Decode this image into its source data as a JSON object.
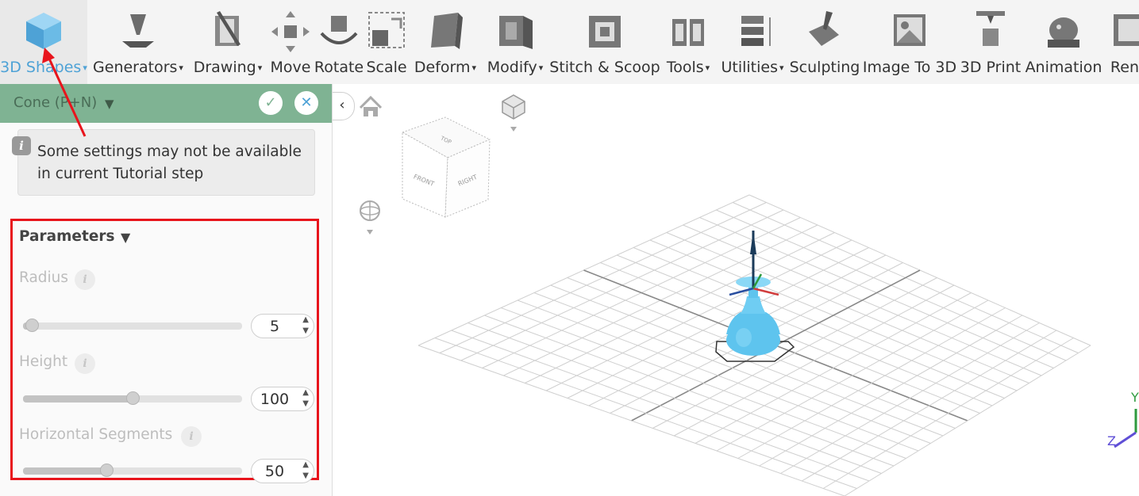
{
  "toolbar": {
    "items": [
      {
        "label": "3D Shapes",
        "icon": "cube-icon",
        "caret": "▾",
        "active": true
      },
      {
        "label": "Generators",
        "icon": "generator-icon",
        "caret": "▾"
      },
      {
        "label": "Drawing",
        "icon": "drawing-icon",
        "caret": "▾"
      },
      {
        "label": "Move",
        "icon": "move-icon",
        "caret": ""
      },
      {
        "label": "Rotate",
        "icon": "rotate-icon",
        "caret": ""
      },
      {
        "label": "Scale",
        "icon": "scale-icon",
        "caret": ""
      },
      {
        "label": "Deform",
        "icon": "deform-icon",
        "caret": "▾"
      },
      {
        "label": "Modify",
        "icon": "modify-icon",
        "caret": "▾"
      },
      {
        "label": "Stitch & Scoop",
        "icon": "stitch-scoop-icon",
        "caret": ""
      },
      {
        "label": "Tools",
        "icon": "tools-icon",
        "caret": "▾"
      },
      {
        "label": "Utilities",
        "icon": "utilities-icon",
        "caret": "▾"
      },
      {
        "label": "Sculpting",
        "icon": "sculpting-icon",
        "caret": ""
      },
      {
        "label": "Image To 3D",
        "icon": "image-to-3d-icon",
        "caret": ""
      },
      {
        "label": "3D Print",
        "icon": "3d-print-icon",
        "caret": ""
      },
      {
        "label": "Animation",
        "icon": "animation-icon",
        "caret": ""
      },
      {
        "label": "Rend",
        "icon": "render-icon",
        "caret": ""
      }
    ]
  },
  "panel": {
    "title": "Cone (P+N)",
    "caret": "▼",
    "confirm_icon": "check-icon",
    "cancel_icon": "close-icon",
    "confirm_symbol": "✓",
    "cancel_symbol": "✕",
    "notice": {
      "icon_text": "i",
      "text": "Some settings may not be available in current Tutorial step"
    },
    "parameters": {
      "title": "Parameters",
      "caret": "▼",
      "info_symbol": "i",
      "items": [
        {
          "label": "Radius",
          "value": "5",
          "slider_fraction": 0.04
        },
        {
          "label": "Height",
          "value": "100",
          "slider_fraction": 0.5
        },
        {
          "label": "Horizontal Segments",
          "value": "50",
          "slider_fraction": 0.38
        }
      ]
    }
  },
  "viewport": {
    "collapse_symbol": "‹",
    "home_icon": "home-icon",
    "view_cube": {
      "top": "TOP",
      "front": "FRONT",
      "right": "RIGHT"
    },
    "axes": {
      "y": "Y",
      "z": "Z"
    },
    "colors": {
      "shape": "#5ec4ee",
      "highlight": "#e8141c",
      "panel_header": "#7fb393",
      "accent": "#4ea2d6"
    }
  }
}
